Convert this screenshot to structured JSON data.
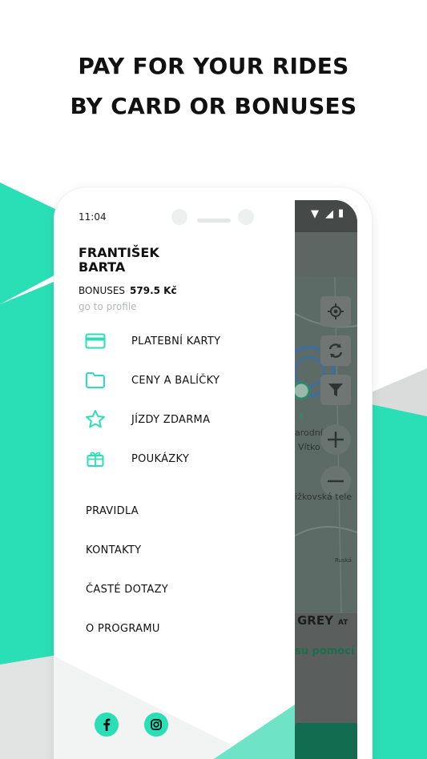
{
  "headline": {
    "line1": "PAY FOR YOUR RIDES",
    "line2": "BY CARD OR BONUSES"
  },
  "colors": {
    "accent": "#2ADFB5",
    "accent_dark": "#116C50",
    "map_overlay": "#5B6562"
  },
  "status_bar": {
    "time": "11:04"
  },
  "drawer": {
    "user_first": "FRANTIŠEK",
    "user_last": "BARTA",
    "bonus_label": "BONUSES",
    "bonus_amount": "579.5 Kč",
    "profile_link": "go to profile",
    "icon_items": [
      {
        "label": "PLATEBNÍ KARTY",
        "icon": "credit-card-icon"
      },
      {
        "label": "CENY A BALÍČKY",
        "icon": "folder-icon"
      },
      {
        "label": "JÍZDY ZDARMA",
        "icon": "star-icon"
      },
      {
        "label": "POUKÁZKY",
        "icon": "gift-icon"
      }
    ],
    "text_items": [
      "PRAVIDLA",
      "KONTAKTY",
      "ČASTÉ DOTAZY",
      "O PROGRAMU"
    ],
    "social": [
      {
        "icon": "facebook-icon"
      },
      {
        "icon": "instagram-icon"
      }
    ]
  },
  "map": {
    "label_1": "arodní",
    "label_2": "Vítko",
    "label_3": "ižkovská tele",
    "label_4": "Ruská",
    "vehicle_name": "GREY",
    "vehicle_suffix": "AT",
    "action_link": "su pomocí"
  }
}
